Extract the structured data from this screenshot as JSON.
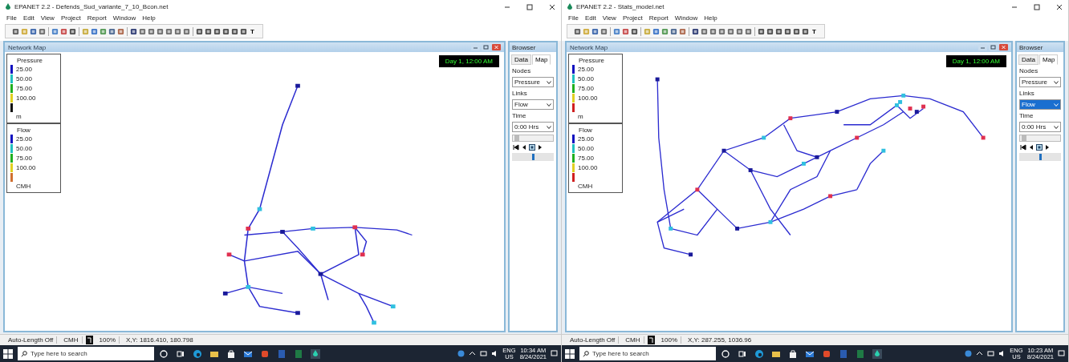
{
  "screens": [
    {
      "title": "EPANET 2.2 - Defends_Sud_variante_7_10_Bcon.net",
      "menu": [
        "File",
        "Edit",
        "View",
        "Project",
        "Report",
        "Window",
        "Help"
      ],
      "toolbar_text": "T",
      "map": {
        "title": "Network Map",
        "time": "Day 1, 12:00 AM",
        "legends": [
          {
            "title": "Pressure",
            "unit": "m",
            "entries": [
              {
                "label": "25.00",
                "color": "#1010c0"
              },
              {
                "label": "50.00",
                "color": "#20c0c0"
              },
              {
                "label": "75.00",
                "color": "#20b020"
              },
              {
                "label": "100.00",
                "color": "#e0d020"
              },
              {
                "color": "#101010"
              }
            ]
          },
          {
            "title": "Flow",
            "unit": "CMH",
            "entries": [
              {
                "label": "25.00",
                "color": "#1010c0"
              },
              {
                "label": "50.00",
                "color": "#20c0c0"
              },
              {
                "label": "75.00",
                "color": "#20b020"
              },
              {
                "label": "100.00",
                "color": "#e0d020"
              },
              {
                "color": "#d07030"
              }
            ]
          }
        ]
      },
      "browser": {
        "title": "Browser",
        "tabs": [
          {
            "label": "Data",
            "selected": false
          },
          {
            "label": "Map",
            "selected": true
          }
        ],
        "nodes_label": "Nodes",
        "nodes_value": "Pressure",
        "links_label": "Links",
        "links_value": "Flow",
        "links_highlighted": false,
        "time_label": "Time",
        "time_value": "0:00 Hrs",
        "time_slider": {
          "level": 0.1
        },
        "speed_slider": {
          "level": 0.5
        }
      },
      "status_bar": {
        "auto_length": "Auto-Length Off",
        "units": "CMH",
        "zoom": "100%",
        "xy": "X,Y: 1816.410, 180.798"
      },
      "taskbar": {
        "search_placeholder": "Type here to search",
        "language": "ENG",
        "region": "US",
        "time": "10:34 AM",
        "date": "8/24/2021"
      }
    },
    {
      "title": "EPANET 2.2 - Stats_model.net",
      "menu": [
        "File",
        "Edit",
        "View",
        "Project",
        "Report",
        "Window",
        "Help"
      ],
      "toolbar_text": "T",
      "map": {
        "title": "Network Map",
        "time": "Day 1, 12:00 AM",
        "legends": [
          {
            "title": "Pressure",
            "unit": "m",
            "entries": [
              {
                "label": "25.00",
                "color": "#1010c0"
              },
              {
                "label": "50.00",
                "color": "#20c0c0"
              },
              {
                "label": "75.00",
                "color": "#20b020"
              },
              {
                "label": "100.00",
                "color": "#e0d020"
              },
              {
                "color": "#d02020"
              }
            ]
          },
          {
            "title": "Flow",
            "unit": "CMH",
            "entries": [
              {
                "label": "25.00",
                "color": "#1010c0"
              },
              {
                "label": "50.00",
                "color": "#20c0c0"
              },
              {
                "label": "75.00",
                "color": "#20b020"
              },
              {
                "label": "100.00",
                "color": "#e0d020"
              },
              {
                "color": "#d02020"
              }
            ]
          }
        ]
      },
      "browser": {
        "title": "Browser",
        "tabs": [
          {
            "label": "Data",
            "selected": false
          },
          {
            "label": "Map",
            "selected": true
          }
        ],
        "nodes_label": "Nodes",
        "nodes_value": "Pressure",
        "links_label": "Links",
        "links_value": "Flow",
        "links_highlighted": true,
        "time_label": "Time",
        "time_value": "0:00 Hrs",
        "time_slider": {
          "level": 0.1
        },
        "speed_slider": {
          "level": 0.5
        }
      },
      "status_bar": {
        "auto_length": "Auto-Length Off",
        "units": "CMH",
        "zoom": "100%",
        "xy": "X,Y: 287.255, 1036.96"
      },
      "taskbar": {
        "search_placeholder": "Type here to search",
        "language": "ENG",
        "region": "US",
        "time": "10:23 AM",
        "date": "8/24/2021"
      }
    }
  ]
}
